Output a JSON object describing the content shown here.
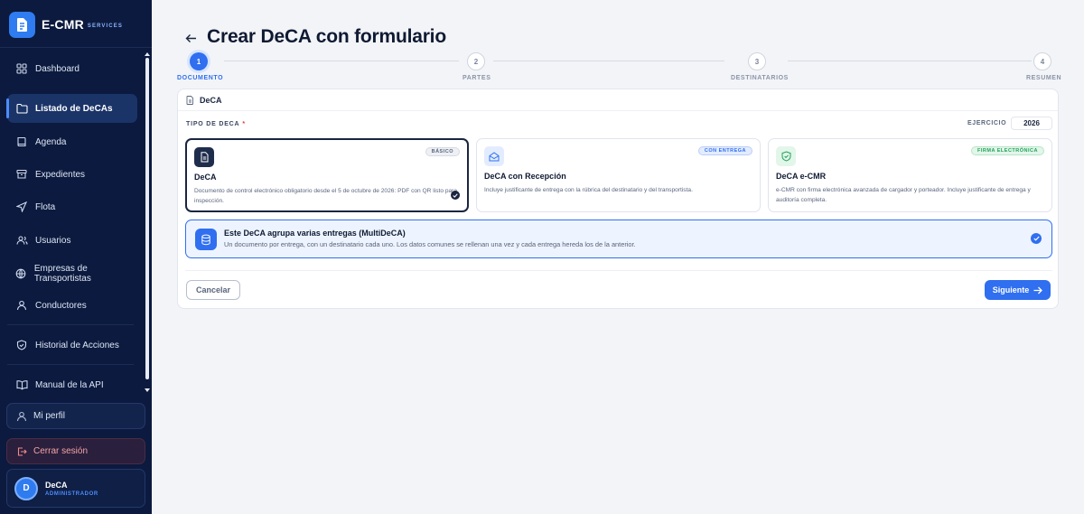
{
  "brand": {
    "name": "E-CMR",
    "sub": "SERVICES",
    "accent": "#2f7bf0"
  },
  "sidebar": {
    "items": [
      {
        "label": "Dashboard",
        "icon": "grid-icon"
      },
      {
        "label": "Listado de DeCAs",
        "icon": "folder-icon",
        "active": true
      },
      {
        "label": "Agenda",
        "icon": "book-icon"
      },
      {
        "label": "Expedientes",
        "icon": "archive-icon"
      },
      {
        "label": "Flota",
        "icon": "navigation-icon"
      },
      {
        "label": "Usuarios",
        "icon": "users-icon"
      },
      {
        "label": "Empresas de Transportistas",
        "icon": "globe-icon"
      },
      {
        "label": "Conductores",
        "icon": "user-icon"
      },
      {
        "label": "Historial de Acciones",
        "icon": "shield-icon"
      },
      {
        "label": "Manual de la API",
        "icon": "open-book-icon"
      }
    ],
    "profile_label": "Mi perfil",
    "logout_label": "Cerrar sesión",
    "user": {
      "initial": "D",
      "name": "DeCA",
      "role": "ADMINISTRADOR"
    }
  },
  "header": {
    "title": "Crear DeCA con formulario"
  },
  "stepper": {
    "steps": [
      {
        "num": "1",
        "label": "DOCUMENTO",
        "active": true
      },
      {
        "num": "2",
        "label": "PARTES"
      },
      {
        "num": "3",
        "label": "DESTINATARIOS"
      },
      {
        "num": "4",
        "label": "RESUMEN"
      }
    ]
  },
  "card": {
    "title": "DeCA",
    "type_label": "TIPO DE DECA",
    "required_mark": "*",
    "year_label": "EJERCICIO",
    "year_value": "2026",
    "options": [
      {
        "badge": "BÁSICO",
        "title": "DeCA",
        "desc": "Documento de control electrónico obligatorio desde el 5 de octubre de 2026: PDF con QR listo para inspección.",
        "selected": true
      },
      {
        "badge": "CON ENTREGA",
        "title": "DeCA con Recepción",
        "desc": "Incluye justificante de entrega con la rúbrica del destinatario y del transportista."
      },
      {
        "badge": "FIRMA ELECTRÓNICA",
        "title": "DeCA e-CMR",
        "desc": "e-CMR con firma electrónica avanzada de cargador y porteador. Incluye justificante de entrega y auditoría completa."
      }
    ],
    "multi": {
      "title": "Este DeCA agrupa varias entregas (MultiDeCA)",
      "desc": "Un documento por entrega, con un destinatario cada uno. Los datos comunes se rellenan una vez y cada entrega hereda los de la anterior.",
      "checked": true
    },
    "cancel_label": "Cancelar",
    "next_label": "Siguiente"
  },
  "colors": {
    "primary": "#2f6ff0",
    "sidebar_bg": "#0b1a3e",
    "danger": "#e23b3b"
  }
}
